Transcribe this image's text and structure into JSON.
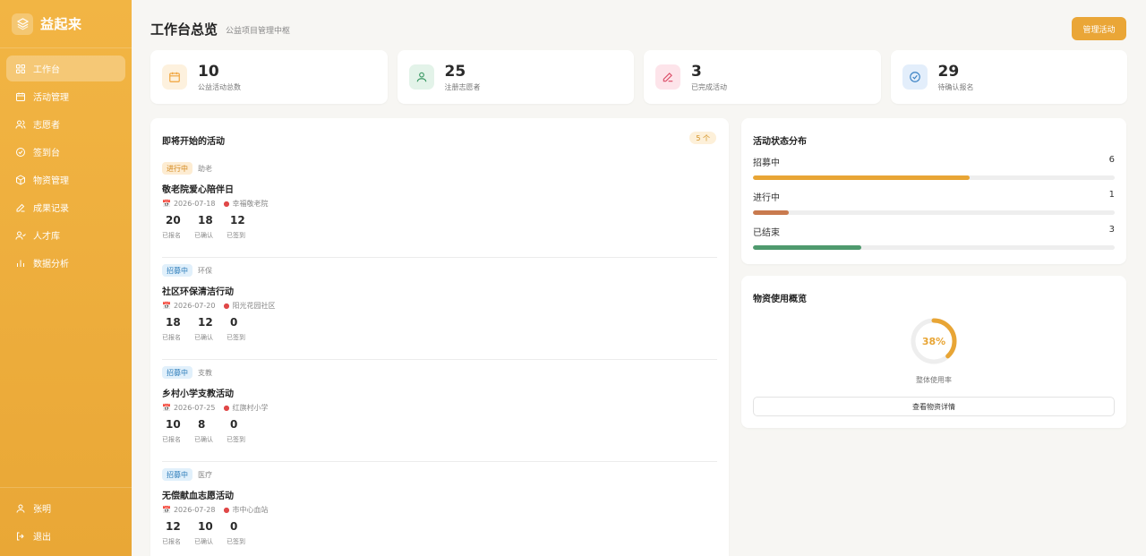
{
  "app": {
    "name": "益起来"
  },
  "sidebar": {
    "items": [
      {
        "label": "工作台",
        "icon": "grid-icon",
        "active": true
      },
      {
        "label": "活动管理",
        "icon": "calendar-icon"
      },
      {
        "label": "志愿者",
        "icon": "users-icon"
      },
      {
        "label": "签到台",
        "icon": "check-circle-icon"
      },
      {
        "label": "物资管理",
        "icon": "box-icon"
      },
      {
        "label": "成果记录",
        "icon": "pen-icon"
      },
      {
        "label": "人才库",
        "icon": "people-icon"
      },
      {
        "label": "数据分析",
        "icon": "bar-chart-icon"
      }
    ],
    "user": {
      "name": "张明",
      "icon": "user-icon"
    },
    "logout": {
      "label": "退出",
      "icon": "logout-icon"
    }
  },
  "header": {
    "title": "工作台总览",
    "subtitle": "公益项目管理中枢",
    "manage_label": "管理活动"
  },
  "stats": [
    {
      "value": "10",
      "label": "公益活动总数",
      "icon": "calendar-icon",
      "color": "#f0a33a",
      "bg": "#fdf1de"
    },
    {
      "value": "25",
      "label": "注册志愿者",
      "icon": "user-icon",
      "color": "#3d9a66",
      "bg": "#e3f3e9"
    },
    {
      "value": "3",
      "label": "已完成活动",
      "icon": "pen-icon",
      "color": "#dc4f6a",
      "bg": "#fde4ea"
    },
    {
      "value": "29",
      "label": "待确认报名",
      "icon": "check-circle-icon",
      "color": "#3b82c4",
      "bg": "#e3eefb"
    }
  ],
  "upcoming": {
    "title": "即将开始的活动",
    "count": "5 个",
    "num_labels": [
      "已报名",
      "已确认",
      "已签到"
    ],
    "activities": [
      {
        "status": "进行中",
        "status_type": "ongoing",
        "category": "助老",
        "title": "敬老院爱心陪伴日",
        "date": "2026-07-18",
        "place": "幸福敬老院",
        "signed": "20",
        "confirmed": "18",
        "checked": "12"
      },
      {
        "status": "招募中",
        "status_type": "recruit",
        "category": "环保",
        "title": "社区环保清洁行动",
        "date": "2026-07-20",
        "place": "阳光花园社区",
        "signed": "18",
        "confirmed": "12",
        "checked": "0"
      },
      {
        "status": "招募中",
        "status_type": "recruit",
        "category": "支教",
        "title": "乡村小学支教活动",
        "date": "2026-07-25",
        "place": "红旗村小学",
        "signed": "10",
        "confirmed": "8",
        "checked": "0"
      },
      {
        "status": "招募中",
        "status_type": "recruit",
        "category": "医疗",
        "title": "无偿献血志愿活动",
        "date": "2026-07-28",
        "place": "市中心血站",
        "signed": "12",
        "confirmed": "10",
        "checked": "0"
      }
    ]
  },
  "status_dist": {
    "title": "活动状态分布",
    "rows": [
      {
        "label": "招募中",
        "value": "6",
        "fraction": 0.6,
        "color": "#e8a535"
      },
      {
        "label": "进行中",
        "value": "1",
        "fraction": 0.1,
        "color": "#c97a4e"
      },
      {
        "label": "已结束",
        "value": "3",
        "fraction": 0.3,
        "color": "#4f9a6e"
      }
    ]
  },
  "material": {
    "title": "物资使用概览",
    "percent_text": "38%",
    "percent": 38,
    "caption": "整体使用率",
    "button_label": "查看物资详情",
    "ring_color": "#e8a535"
  }
}
